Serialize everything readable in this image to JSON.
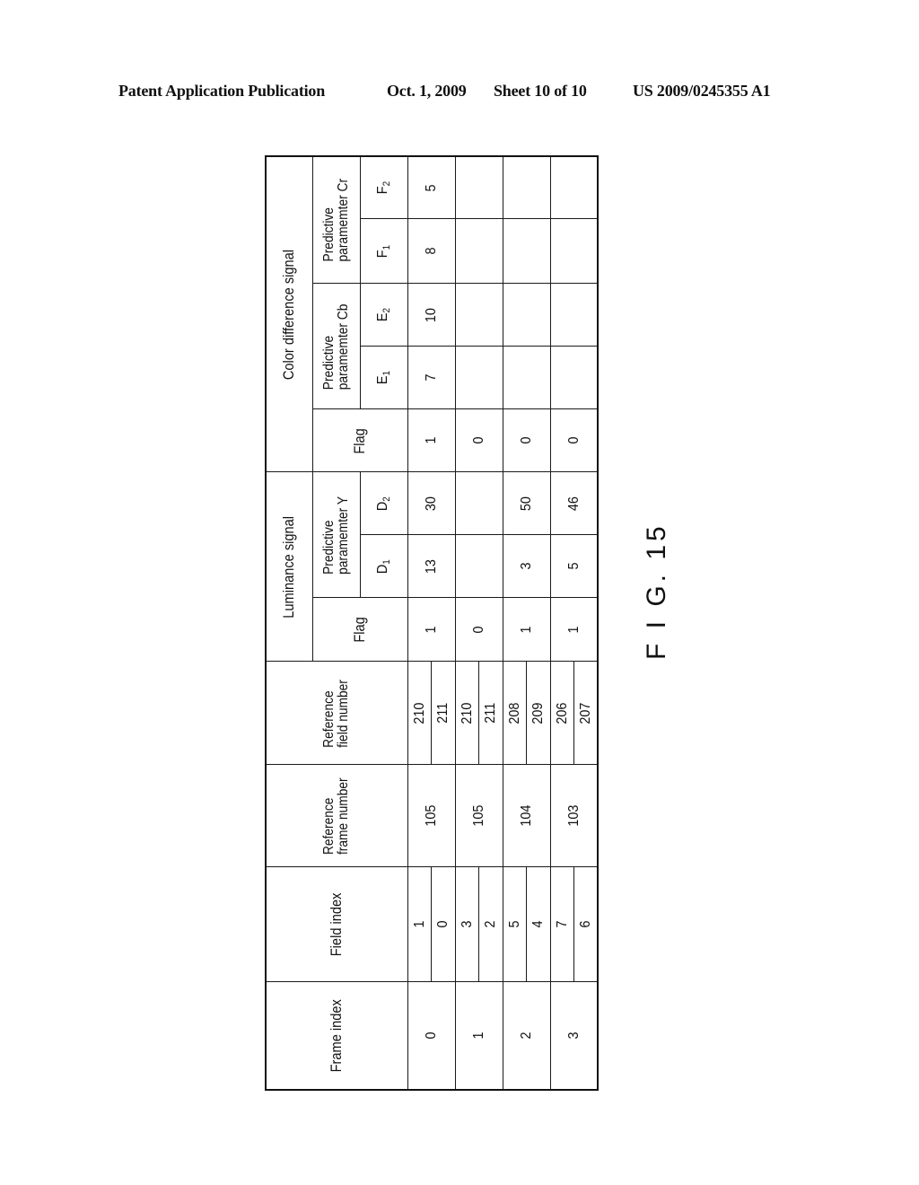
{
  "page_header": {
    "publication": "Patent Application Publication",
    "date": "Oct. 1, 2009",
    "sheet": "Sheet 10 of 10",
    "patent_number": "US 2009/0245355 A1"
  },
  "figure_label": "F I G. 15",
  "table": {
    "headers": {
      "frame_index": "Frame index",
      "field_index": "Field index",
      "reference_frame_number_line1": "Reference",
      "reference_frame_number_line2": "frame number",
      "reference_field_number_line1": "Reference",
      "reference_field_number_line2": "field number",
      "luminance_signal": "Luminance signal",
      "color_difference_signal": "Color difference signal",
      "flag": "Flag",
      "pred_y_line1": "Predictive",
      "pred_y_line2": "paramemter  Y",
      "pred_cb_line1": "Predictive",
      "pred_cb_line2": "paramemter  Cb",
      "pred_cr_line1": "Predictive",
      "pred_cr_line2": "paramemter  Cr",
      "d1": "D",
      "d1_sub": "1",
      "d2": "D",
      "d2_sub": "2",
      "e1": "E",
      "e1_sub": "1",
      "e2": "E",
      "e2_sub": "2",
      "f1": "F",
      "f1_sub": "1",
      "f2": "F",
      "f2_sub": "2"
    },
    "rows": [
      {
        "frame_index": "0",
        "field_index": [
          "1",
          "0"
        ],
        "ref_frame": "105",
        "ref_field": [
          "210",
          "211"
        ],
        "luma_flag": "1",
        "d1": "13",
        "d2": "30",
        "chroma_flag": "1",
        "e1": "7",
        "e2": "10",
        "f1": "8",
        "f2": "5"
      },
      {
        "frame_index": "1",
        "field_index": [
          "3",
          "2"
        ],
        "ref_frame": "105",
        "ref_field": [
          "210",
          "211"
        ],
        "luma_flag": "0",
        "d1": "",
        "d2": "",
        "chroma_flag": "0",
        "e1": "",
        "e2": "",
        "f1": "",
        "f2": ""
      },
      {
        "frame_index": "2",
        "field_index": [
          "5",
          "4"
        ],
        "ref_frame": "104",
        "ref_field": [
          "208",
          "209"
        ],
        "luma_flag": "1",
        "d1": "3",
        "d2": "50",
        "chroma_flag": "0",
        "e1": "",
        "e2": "",
        "f1": "",
        "f2": ""
      },
      {
        "frame_index": "3",
        "field_index": [
          "7",
          "6"
        ],
        "ref_frame": "103",
        "ref_field": [
          "206",
          "207"
        ],
        "luma_flag": "1",
        "d1": "5",
        "d2": "46",
        "chroma_flag": "0",
        "e1": "",
        "e2": "",
        "f1": "",
        "f2": ""
      }
    ]
  }
}
